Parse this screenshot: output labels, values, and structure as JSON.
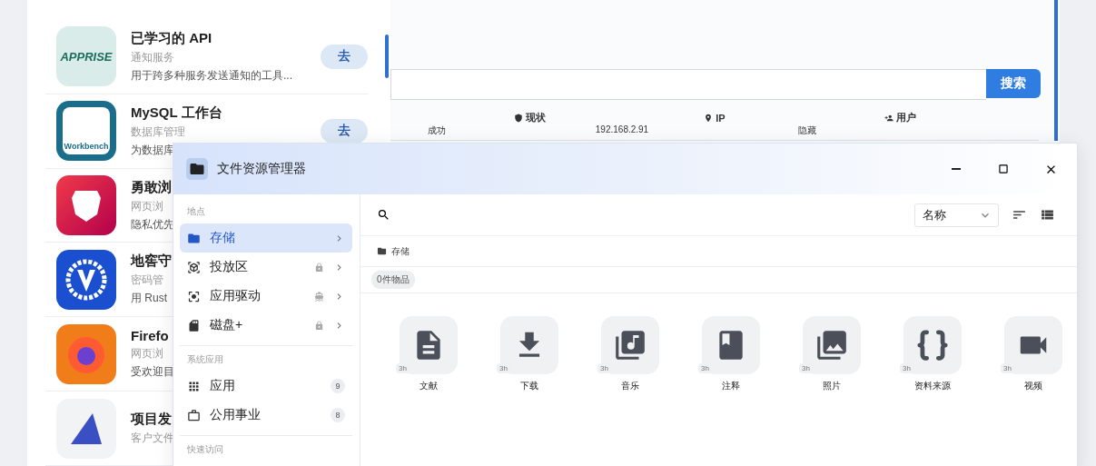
{
  "apps": [
    {
      "name": "已学习的 API",
      "category": "通知服务",
      "description": "用于跨多种服务发送通知的工具...",
      "button": "去",
      "kind": "apprise",
      "logo_text": "APPRISE"
    },
    {
      "name": "MySQL 工作台",
      "category": "数据库管理",
      "description": "为数据库",
      "button": "去",
      "kind": "mysql",
      "logo_text": "Workbench"
    },
    {
      "name": "勇敢浏",
      "category": "网页浏",
      "description": "隐私优先",
      "kind": "brave"
    },
    {
      "name": "地窖守",
      "category": "密码管",
      "description": "用 Rust",
      "kind": "vault"
    },
    {
      "name": "Firefo",
      "category": "网页浏",
      "description": "受欢迎目",
      "kind": "firefox"
    },
    {
      "name": "项目发",
      "category": "客户文件",
      "kind": "projectsend"
    }
  ],
  "back_panel": {
    "search_button": "搜索",
    "columns": [
      {
        "label": "现状"
      },
      {
        "label": "IP"
      },
      {
        "label": "用户"
      }
    ],
    "rows": [
      [
        "成功",
        "192.168.2.91",
        "隐藏"
      ]
    ]
  },
  "window": {
    "title": "文件资源管理器",
    "sidebar": [
      {
        "kind": "locations",
        "title": "地点",
        "items": [
          {
            "label": "存储",
            "selected": true,
            "locked": false
          },
          {
            "label": "投放区",
            "selected": false,
            "locked": true
          },
          {
            "label": "应用驱动",
            "selected": false,
            "locked": false
          },
          {
            "label": "磁盘+",
            "selected": false,
            "locked": true
          }
        ]
      },
      {
        "kind": "apps",
        "title": "系统应用",
        "items": [
          {
            "label": "应用",
            "selected": false,
            "count": "9"
          },
          {
            "label": "公用事业",
            "selected": false,
            "count": "8"
          }
        ]
      },
      {
        "title": "快速访问"
      }
    ],
    "sort_select": "名称",
    "breadcrumb": "存储",
    "item_count": "0件物品",
    "folders": [
      {
        "label": "文献",
        "age": "3h"
      },
      {
        "label": "下载",
        "age": "3h"
      },
      {
        "label": "音乐",
        "age": "3h"
      },
      {
        "label": "注释",
        "age": "3h"
      },
      {
        "label": "照片",
        "age": "3h"
      },
      {
        "label": "资料来源",
        "age": "3h"
      },
      {
        "label": "视频",
        "age": "3h"
      }
    ]
  }
}
